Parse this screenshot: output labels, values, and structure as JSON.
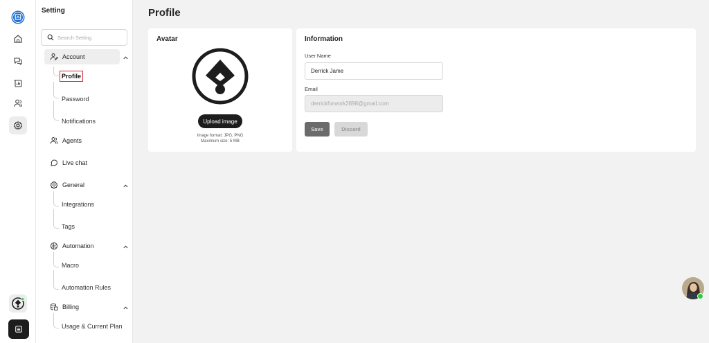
{
  "sidebar": {
    "title": "Setting",
    "search_placeholder": "Search Setting",
    "groups": [
      {
        "label": "Account",
        "items": [
          "Profile",
          "Password",
          "Notifications"
        ]
      },
      {
        "label": "Agents"
      },
      {
        "label": "Live chat"
      },
      {
        "label": "General",
        "items": [
          "Integrations",
          "Tags"
        ]
      },
      {
        "label": "Automation",
        "items": [
          "Macro",
          "Automation Rules"
        ]
      },
      {
        "label": "Billing",
        "items": [
          "Usage & Current Plan"
        ]
      }
    ],
    "current_item": "Profile"
  },
  "page": {
    "title": "Profile",
    "avatar_card": {
      "title": "Avatar",
      "upload_label": "Upload image",
      "format_hint": "Image format: JPG, PNG",
      "size_hint": "Maximum size: 5 MB"
    },
    "info_card": {
      "title": "Information",
      "username_label": "User Name",
      "username_value": "Derrick Jame",
      "email_label": "Email",
      "email_value": "derrickforwork2898@gmail.com",
      "save_label": "Save",
      "discard_label": "Discard"
    }
  },
  "rail_icons": [
    "logo-icon",
    "home-icon",
    "chat-icon",
    "report-icon",
    "users-icon",
    "settings-icon",
    "brand-icon",
    "menu-icon"
  ],
  "colors": {
    "accent_dark": "#1d1d1d",
    "highlight_border": "#d62828",
    "online": "#2ecc40"
  }
}
